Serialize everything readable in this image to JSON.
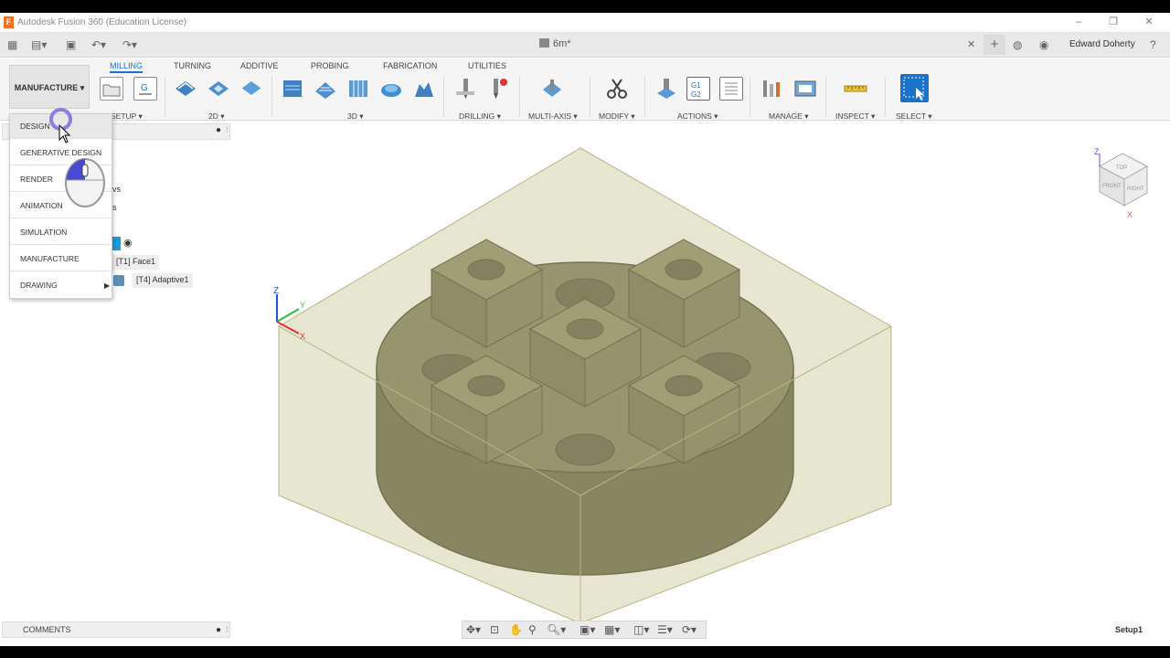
{
  "app": {
    "title": "Autodesk Fusion 360 (Education License)",
    "logo_letter": "F",
    "document_name": "6m*",
    "user_name": "Edward Doherty"
  },
  "ribbon": {
    "workspace_label": "MANUFACTURE ▾",
    "tabs": [
      "MILLING",
      "TURNING",
      "ADDITIVE",
      "PROBING",
      "FABRICATION",
      "UTILITIES"
    ],
    "active_tab": "MILLING",
    "groups": [
      "SETUP ▾",
      "2D ▾",
      "3D ▾",
      "DRILLING ▾",
      "MULTI-AXIS ▾",
      "MODIFY ▾",
      "ACTIONS ▾",
      "MANAGE ▾",
      "INSPECT ▾",
      "SELECT ▾"
    ],
    "g1g2_text": "G1\nG2"
  },
  "workspace_menu": {
    "items": [
      "DESIGN",
      "GENERATIVE DESIGN",
      "RENDER",
      "ANIMATION",
      "SIMULATION",
      "MANUFACTURE",
      "DRAWING"
    ],
    "highlighted": "DESIGN"
  },
  "browser": {
    "partial_items": [
      "vs",
      "s"
    ],
    "ops": [
      "[T1] Face1",
      "[T4] Adaptive1"
    ]
  },
  "viewcube": {
    "faces": [
      "TOP",
      "FRONT",
      "RIGHT"
    ],
    "axes": [
      "Z",
      "X"
    ]
  },
  "triad_axes": [
    "Z",
    "Y",
    "X"
  ],
  "status": {
    "comments_label": "COMMENTS",
    "setup_label": "Setup1"
  },
  "colors": {
    "accent": "#1a73c8",
    "stock": "#c9c99a",
    "part": "#6e6b4a"
  }
}
